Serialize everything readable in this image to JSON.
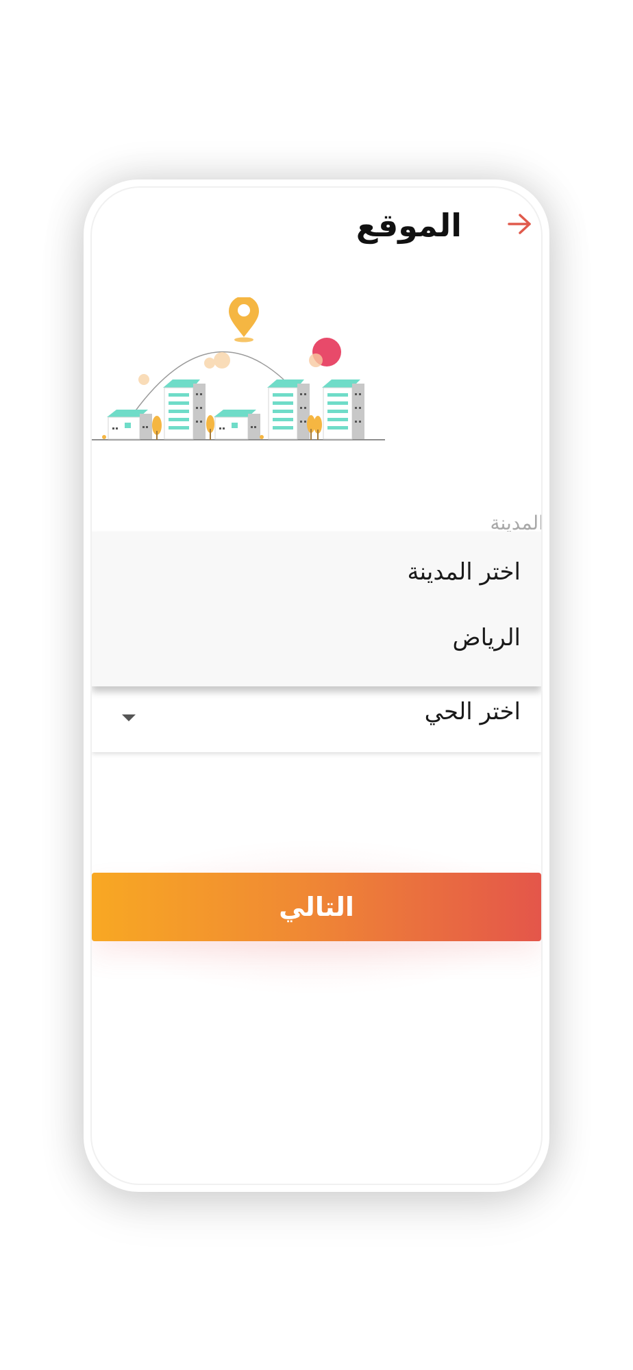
{
  "header": {
    "title": "الموقع",
    "back_icon": "arrow-right-icon"
  },
  "city": {
    "label": "المدينة",
    "options": [
      "اختر المدينة",
      "الرياض"
    ]
  },
  "district": {
    "value": "اختر الحي",
    "caret_icon": "caret-down-icon"
  },
  "next_button": {
    "label": "التالي"
  },
  "colors": {
    "accent_orange": "#f8a823",
    "accent_red": "#e4564a",
    "back_arrow": "#e05a4c",
    "building_teal": "#6fdcc8",
    "pin_yellow": "#f5b642",
    "sun_red": "#e84a6a"
  }
}
